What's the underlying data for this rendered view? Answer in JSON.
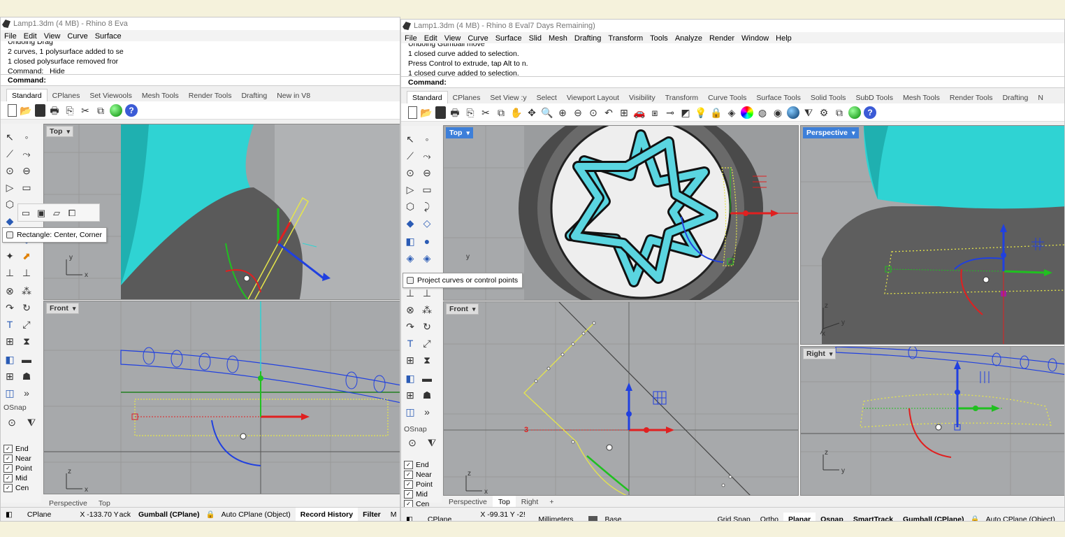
{
  "left": {
    "title": "Lamp1.3dm (4 MB) - Rhino 8 Eva",
    "menu": [
      "File",
      "Edit",
      "View",
      "Curve",
      "Surface"
    ],
    "history": [
      "Undoing Drag",
      "2 curves, 1 polysurface added to se",
      "1 closed polysurface removed fror",
      "Command: _Hide"
    ],
    "command_label": "Command:",
    "tabs": [
      "Standard",
      "CPlanes",
      "Set Viewools",
      "Mesh Tools",
      "Render Tools",
      "Drafting",
      "New in V8"
    ],
    "viewport_top": "Top",
    "viewport_front": "Front",
    "tooltip": "Rectangle: Center, Corner",
    "osnap": "OSnap",
    "osnap_items": [
      "End",
      "Near",
      "Point",
      "Mid",
      "Cen"
    ],
    "bottom_tabs": [
      "Perspective",
      "Top"
    ],
    "status": {
      "cplane": "CPlane",
      "coords": "X -133.70 Y",
      "ack": "ack",
      "gumball": "Gumball (CPlane)",
      "auto_cplane": "Auto CPlane (Object)",
      "record": "Record History",
      "filter": "Filter",
      "m": "M"
    }
  },
  "right": {
    "title": "Lamp1.3dm (4 MB) - Rhino 8 Eval7 Days Remaining)",
    "menu": [
      "File",
      "Edit",
      "View",
      "Curve",
      "Surface",
      "Slid",
      "Mesh",
      "Drafting",
      "Transform",
      "Tools",
      "Analyze",
      "Render",
      "Window",
      "Help"
    ],
    "history": [
      "Undoing Gumball move",
      "1 closed curve added to selection.",
      "Press Control to extrude, tap Alt to n.",
      "1 closed curve added to selection."
    ],
    "command_label": "Command:",
    "tabs": [
      "Standard",
      "CPlanes",
      "Set View :y",
      "Select",
      "Viewport Layout",
      "Visibility",
      "Transform",
      "Curve Tools",
      "Surface Tools",
      "Solid Tools",
      "SubD Tools",
      "Mesh Tools",
      "Render Tools",
      "Drafting",
      "N"
    ],
    "viewport_top": "Top",
    "viewport_perspective": "Perspective",
    "viewport_front": "Front",
    "viewport_right": "Right",
    "tooltip": "Project curves or control points",
    "osnap": "OSnap",
    "osnap_items": [
      "End",
      "Near",
      "Point",
      "Mid",
      "Cen"
    ],
    "bottom_tabs": [
      "Perspective",
      "Top",
      "Right",
      "+"
    ],
    "status": {
      "cplane": "CPlane",
      "coords": "X -99.31 Y -2!",
      "units": "Millimeters",
      "layer": "Base",
      "grid": "Grid Snap",
      "ortho": "Ortho",
      "planar": "Planar",
      "osnap": "Osnap",
      "smarttrack": "SmartTrack",
      "gumball": "Gumball (CPlane)",
      "auto_cplane": "Auto CPlane (Object)"
    }
  },
  "axis": {
    "x": "x",
    "y": "y",
    "z": "z",
    "three": "3"
  },
  "colors": {
    "cyan": "#2fd3d3",
    "viewport_bg": "#a7a9ab",
    "selection": "#e6e64a",
    "gumball_red": "#e02020",
    "gumball_green": "#20c020",
    "gumball_blue": "#2040e0",
    "active_tab": "#3d7fd9"
  }
}
